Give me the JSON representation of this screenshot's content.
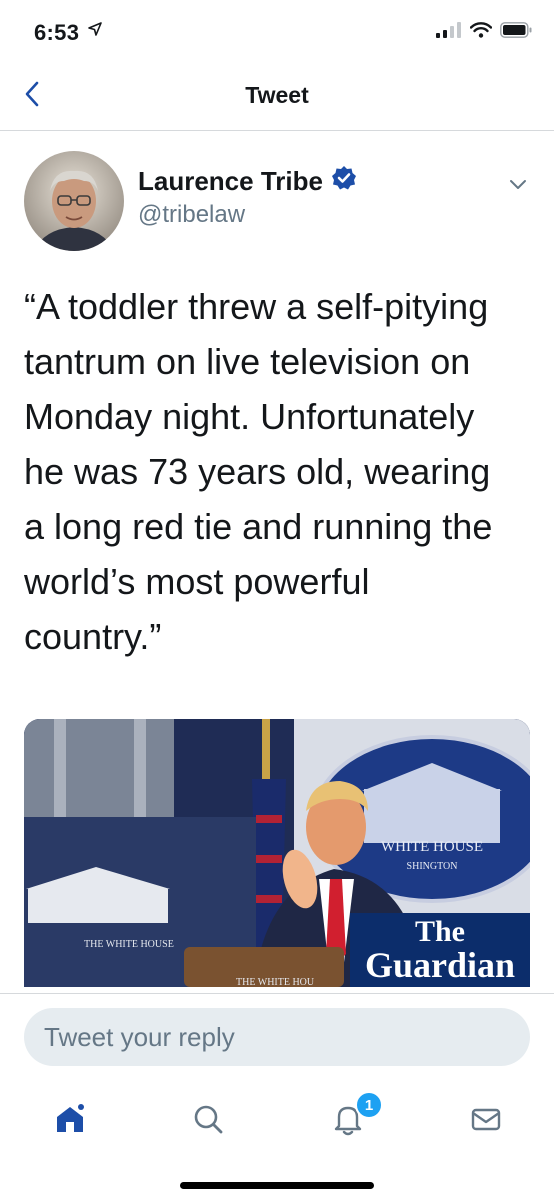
{
  "status_bar": {
    "time": "6:53"
  },
  "nav": {
    "title": "Tweet"
  },
  "tweet": {
    "author_name": "Laurence Tribe",
    "author_handle": "@tribelaw",
    "text_lines": [
      "“A toddler threw a self-pitying",
      "tantrum on live television on",
      "Monday night. Unfortunately",
      "he was 73 years old, wearing",
      "a long red tie and running the",
      "world’s most powerful",
      "country.”"
    ],
    "media": {
      "podium_text": "THE WHITE HOUSE",
      "seal_text_1": "WHITE HOUSE",
      "seal_text_2": "SHINGTON",
      "lectern_text": "THE WHITE HOU",
      "guardian_logo_1": "The",
      "guardian_logo_2": "Guardian"
    }
  },
  "reply": {
    "placeholder": "Tweet your reply"
  },
  "tabs": {
    "notifications_count": "1",
    "icons": [
      "home-icon",
      "search-icon",
      "notifications-icon",
      "messages-icon"
    ]
  },
  "colors": {
    "accent": "#1da1f2",
    "tab_active": "#1d4ea8",
    "verified": "#1da1f2",
    "handle_gray": "#657786",
    "input_bg": "#e6ecf0"
  }
}
